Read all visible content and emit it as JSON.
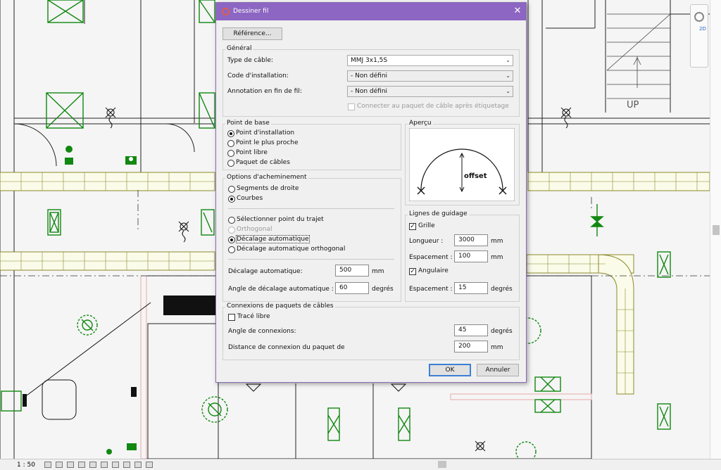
{
  "dialog": {
    "title": "Dessiner fil",
    "reference_button": "Référence...",
    "general": {
      "legend": "Général",
      "cable_type_label": "Type de câble:",
      "cable_type_value": "MMJ 3x1,5S",
      "install_code_label": "Code d'installation:",
      "install_code_value": "- Non défini",
      "annotation_label": "Annotation en fin de fil:",
      "annotation_value": "- Non défini",
      "connect_label": "Connecter au paquet de câble après étiquetage"
    },
    "base_point": {
      "legend": "Point de base",
      "options": [
        "Point d'installation",
        "Point le plus proche",
        "Point libre",
        "Paquet de câbles"
      ],
      "selected": 0
    },
    "preview": {
      "legend": "Aperçu",
      "offset_label": "offset"
    },
    "routing": {
      "legend": "Options d'acheminement",
      "options": [
        "Segments de droite",
        "Courbes"
      ],
      "selected": 1,
      "path_options": [
        "Sélectionner point du trajet",
        "Orthogonal",
        "Décalage automatique",
        "Décalage automatique orthogonal"
      ],
      "path_selected": 2,
      "auto_offset_label": "Décalage automatique:",
      "auto_offset_value": "500",
      "auto_offset_unit": "mm",
      "auto_offset_angle_label": "Angle de décalage automatique :",
      "auto_offset_angle_value": "60",
      "auto_offset_angle_unit": "degrés"
    },
    "guides": {
      "legend": "Lignes de guidage",
      "grid_label": "Grille",
      "length_label": "Longueur :",
      "length_value": "3000",
      "length_unit": "mm",
      "spacing_label": "Espacement :",
      "spacing_value": "100",
      "spacing_unit": "mm",
      "angular_label": "Angulaire",
      "angular_spacing_label": "Espacement :",
      "angular_spacing_value": "15",
      "angular_spacing_unit": "degrés"
    },
    "bundle": {
      "legend": "Connexions de paquets de câbles",
      "free_trace_label": "Tracé libre",
      "angle_label": "Angle de connexions:",
      "angle_value": "45",
      "angle_unit": "degrés",
      "distance_label": "Distance de connexion du paquet de",
      "distance_value": "200",
      "distance_unit": "mm"
    },
    "ok_button": "OK",
    "cancel_button": "Annuler"
  },
  "canvas": {
    "stair_label": "UP"
  },
  "statusbar": {
    "scale": "1 : 50"
  },
  "navbar": {
    "mode": "2D"
  },
  "colors": {
    "titlebar": "#8c66c2",
    "drawing_line": "#1a1a1a",
    "fixture_green": "#118811",
    "wall_hatch": "#e8a9a9",
    "duct": "#8a8a2a"
  }
}
